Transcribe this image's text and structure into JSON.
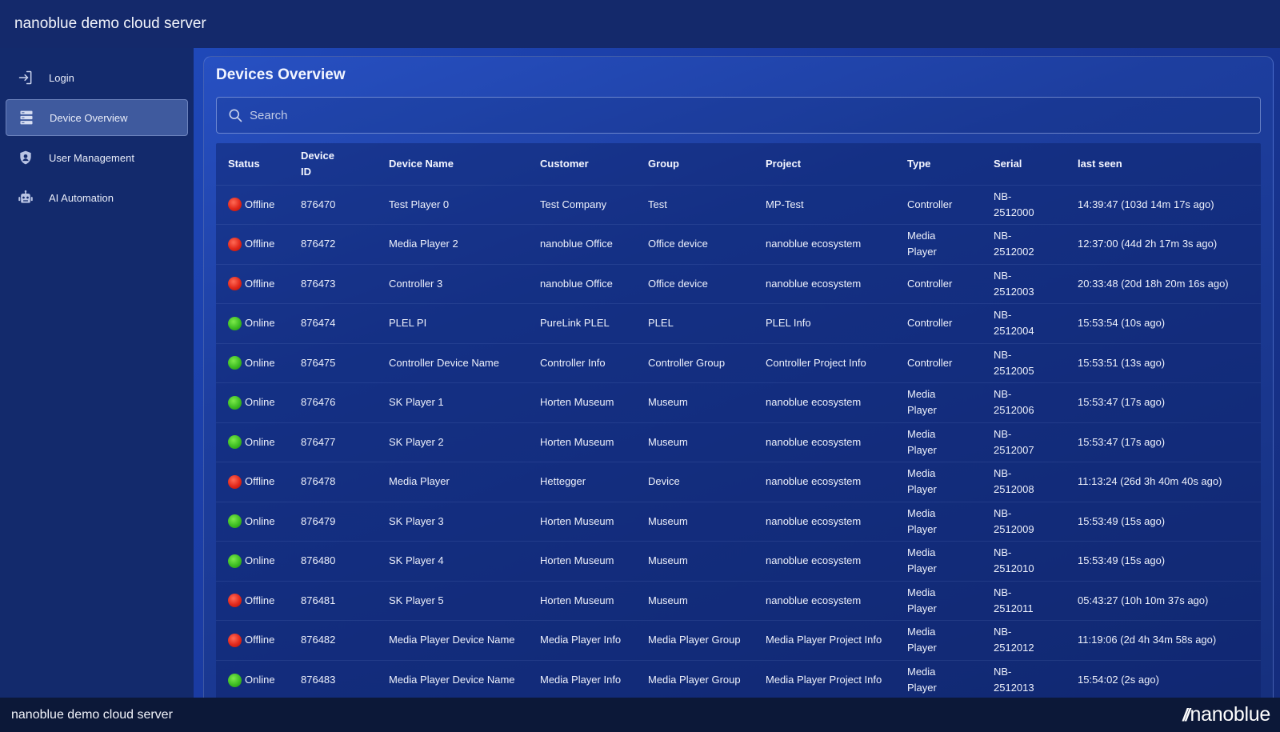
{
  "app": {
    "title": "nanoblue demo cloud server"
  },
  "sidebar": {
    "items": [
      {
        "label": "Login",
        "icon": "login-icon",
        "active": false
      },
      {
        "label": "Device Overview",
        "icon": "server-icon",
        "active": true
      },
      {
        "label": "User Management",
        "icon": "shield-user-icon",
        "active": false
      },
      {
        "label": "AI Automation",
        "icon": "robot-icon",
        "active": false
      }
    ]
  },
  "main": {
    "title": "Devices Overview",
    "search": {
      "placeholder": "Search",
      "value": ""
    },
    "table": {
      "headers": [
        "Status",
        "Device ID",
        "Device Name",
        "Customer",
        "Group",
        "Project",
        "Type",
        "Serial",
        "last seen"
      ],
      "rows": [
        {
          "status": "Offline",
          "id": "876470",
          "name": "Test Player 0",
          "customer": "Test Company",
          "group": "Test",
          "project": "MP-Test",
          "type": "Controller",
          "serial": "NB-2512000",
          "last_seen": "14:39:47 (103d 14m 17s ago)"
        },
        {
          "status": "Offline",
          "id": "876472",
          "name": "Media Player 2",
          "customer": "nanoblue Office",
          "group": "Office device",
          "project": "nanoblue ecosystem",
          "type": "Media Player",
          "serial": "NB-2512002",
          "last_seen": "12:37:00 (44d 2h 17m 3s ago)"
        },
        {
          "status": "Offline",
          "id": "876473",
          "name": "Controller 3",
          "customer": "nanoblue Office",
          "group": "Office device",
          "project": "nanoblue ecosystem",
          "type": "Controller",
          "serial": "NB-2512003",
          "last_seen": "20:33:48 (20d 18h 20m 16s ago)"
        },
        {
          "status": "Online",
          "id": "876474",
          "name": "PLEL PI",
          "customer": "PureLink PLEL",
          "group": "PLEL",
          "project": "PLEL Info",
          "type": "Controller",
          "serial": "NB-2512004",
          "last_seen": "15:53:54 (10s ago)"
        },
        {
          "status": "Online",
          "id": "876475",
          "name": "Controller Device Name",
          "customer": "Controller Info",
          "group": "Controller Group",
          "project": "Controller Project Info",
          "type": "Controller",
          "serial": "NB-2512005",
          "last_seen": "15:53:51 (13s ago)"
        },
        {
          "status": "Online",
          "id": "876476",
          "name": "SK Player 1",
          "customer": "Horten Museum",
          "group": "Museum",
          "project": "nanoblue ecosystem",
          "type": "Media Player",
          "serial": "NB-2512006",
          "last_seen": "15:53:47 (17s ago)"
        },
        {
          "status": "Online",
          "id": "876477",
          "name": "SK Player 2",
          "customer": "Horten Museum",
          "group": "Museum",
          "project": "nanoblue ecosystem",
          "type": "Media Player",
          "serial": "NB-2512007",
          "last_seen": "15:53:47 (17s ago)"
        },
        {
          "status": "Offline",
          "id": "876478",
          "name": "Media Player",
          "customer": "Hettegger",
          "group": "Device",
          "project": "nanoblue ecosystem",
          "type": "Media Player",
          "serial": "NB-2512008",
          "last_seen": "11:13:24 (26d 3h 40m 40s ago)"
        },
        {
          "status": "Online",
          "id": "876479",
          "name": "SK Player 3",
          "customer": "Horten Museum",
          "group": "Museum",
          "project": "nanoblue ecosystem",
          "type": "Media Player",
          "serial": "NB-2512009",
          "last_seen": "15:53:49 (15s ago)"
        },
        {
          "status": "Online",
          "id": "876480",
          "name": "SK Player 4",
          "customer": "Horten Museum",
          "group": "Museum",
          "project": "nanoblue ecosystem",
          "type": "Media Player",
          "serial": "NB-2512010",
          "last_seen": "15:53:49 (15s ago)"
        },
        {
          "status": "Offline",
          "id": "876481",
          "name": "SK Player 5",
          "customer": "Horten Museum",
          "group": "Museum",
          "project": "nanoblue ecosystem",
          "type": "Media Player",
          "serial": "NB-2512011",
          "last_seen": "05:43:27 (10h 10m 37s ago)"
        },
        {
          "status": "Offline",
          "id": "876482",
          "name": "Media Player Device Name",
          "customer": "Media Player Info",
          "group": "Media Player Group",
          "project": "Media Player Project Info",
          "type": "Media Player",
          "serial": "NB-2512012",
          "last_seen": "11:19:06 (2d 4h 34m 58s ago)"
        },
        {
          "status": "Online",
          "id": "876483",
          "name": "Media Player Device Name",
          "customer": "Media Player Info",
          "group": "Media Player Group",
          "project": "Media Player Project Info",
          "type": "Media Player",
          "serial": "NB-2512013",
          "last_seen": "15:54:02 (2s ago)"
        }
      ]
    }
  },
  "footer": {
    "text": "nanoblue demo cloud server",
    "brand": "nanoblue",
    "brand_mark": "//"
  },
  "colors": {
    "online": "#3cbc22",
    "offline": "#e0271a",
    "accent": "#1f48b8"
  }
}
